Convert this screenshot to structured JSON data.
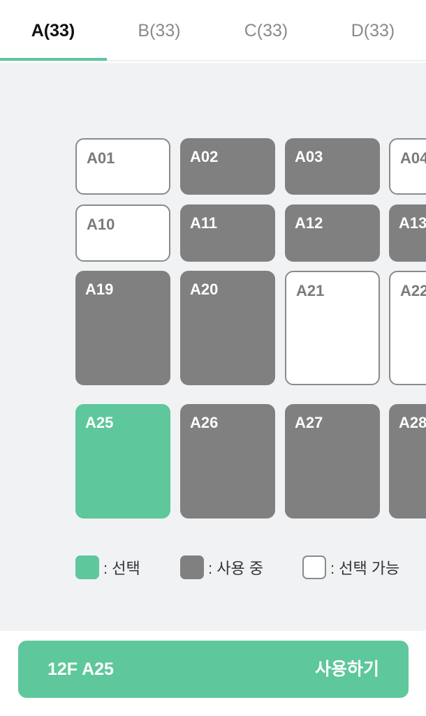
{
  "tabs": [
    {
      "label": "A(33)",
      "active": true
    },
    {
      "label": "B(33)",
      "active": false
    },
    {
      "label": "C(33)",
      "active": false
    },
    {
      "label": "D(33)",
      "active": false
    }
  ],
  "seats": [
    {
      "id": "A01",
      "status": "free"
    },
    {
      "id": "A02",
      "status": "used"
    },
    {
      "id": "A03",
      "status": "used"
    },
    {
      "id": "A04",
      "status": "free"
    },
    {
      "id": "A10",
      "status": "free"
    },
    {
      "id": "A11",
      "status": "used"
    },
    {
      "id": "A12",
      "status": "used"
    },
    {
      "id": "A13",
      "status": "used"
    },
    {
      "id": "A19",
      "status": "used"
    },
    {
      "id": "A20",
      "status": "used"
    },
    {
      "id": "A21",
      "status": "free"
    },
    {
      "id": "A22",
      "status": "free"
    },
    {
      "id": "A25",
      "status": "selected"
    },
    {
      "id": "A26",
      "status": "used"
    },
    {
      "id": "A27",
      "status": "used"
    },
    {
      "id": "A28",
      "status": "used"
    }
  ],
  "legend": {
    "selected": ": 선택",
    "in_use": ": 사용 중",
    "available": ": 선택 가능"
  },
  "action": {
    "selection": "12F A25",
    "label": "사용하기"
  },
  "colors": {
    "accent": "#5ec79b",
    "used": "#808080",
    "free_border": "#8a8a8a",
    "background": "#f1f2f4"
  }
}
